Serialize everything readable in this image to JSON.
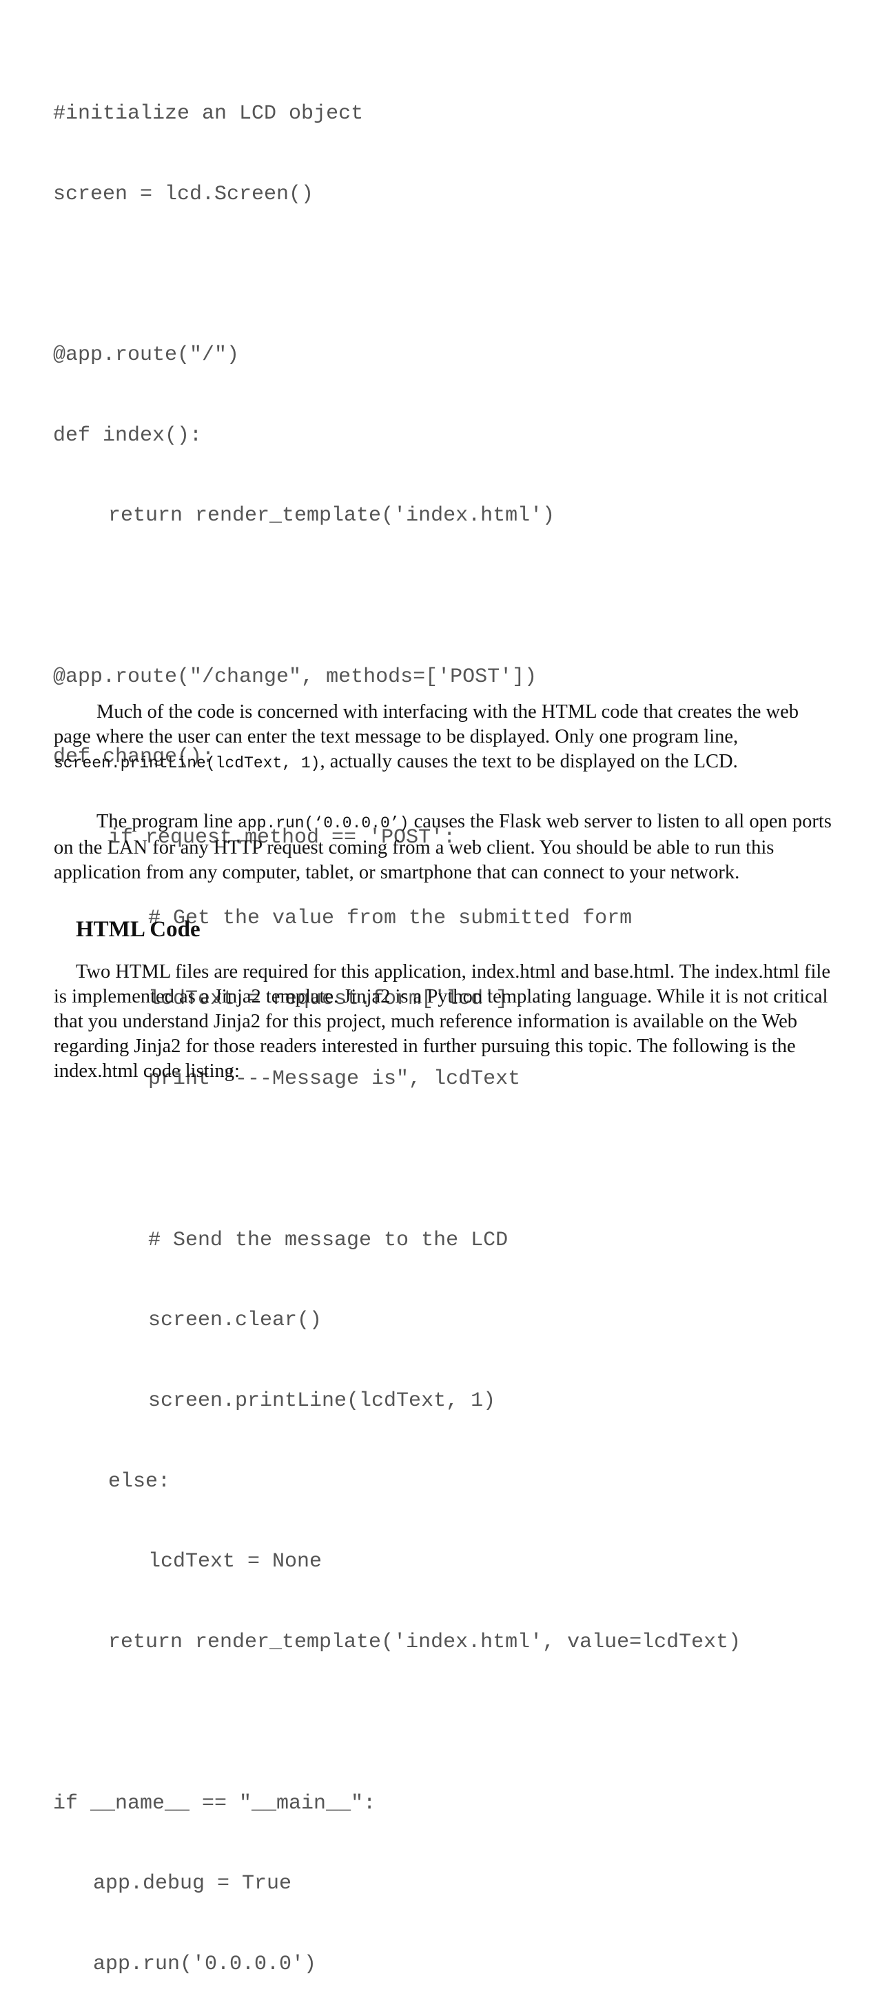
{
  "code_listing": {
    "lines": [
      "#initialize an LCD object",
      "screen = lcd.Screen()",
      "",
      "@app.route(\"/\")",
      "def index():",
      "return render_template('index.html')",
      "",
      "@app.route(\"/change\", methods=['POST'])",
      "def change():",
      "if request.method == 'POST':",
      "# Get the value from the submitted form",
      "lcdText = request.form['lcd']",
      "print \"---Message is\", lcdText",
      "",
      "# Send the message to the LCD",
      "screen.clear()",
      "screen.printLine(lcdText, 1)",
      "else:",
      "lcdText = None",
      "return render_template('index.html', value=lcdText)",
      "",
      "if __name__ == \"__main__\":",
      "app.debug = True",
      "app.run('0.0.0.0')"
    ]
  },
  "paragraph_1": {
    "before": "Much of the code is concerned with interfacing with the HTML code that creates the web page where the user can enter the text message to be displayed. Only one program line, ",
    "code": "screen.printLine(lcdText, 1)",
    "after": ", actually causes the text to be displayed on the LCD."
  },
  "paragraph_2": {
    "before": "The program line ",
    "code": "app.run(‘0.0.0.0’)",
    "after": " causes the Flask web server to listen to all open ports on the LAN for any HTTP request coming from a web client. You should be able to run this application from any computer, tablet, or smartphone that can connect to your network."
  },
  "section_heading": "HTML Code",
  "paragraph_3": "Two HTML files are required for this application, index.html and base.html. The index.html file is implemented as a Jinja2 template. Jinja2 is a Python templating language. While it is not critical that you understand Jinja2 for this project, much reference information is available on the Web regarding Jinja2 for those readers interested in further pursuing this topic. The following is the index.html code listing:"
}
